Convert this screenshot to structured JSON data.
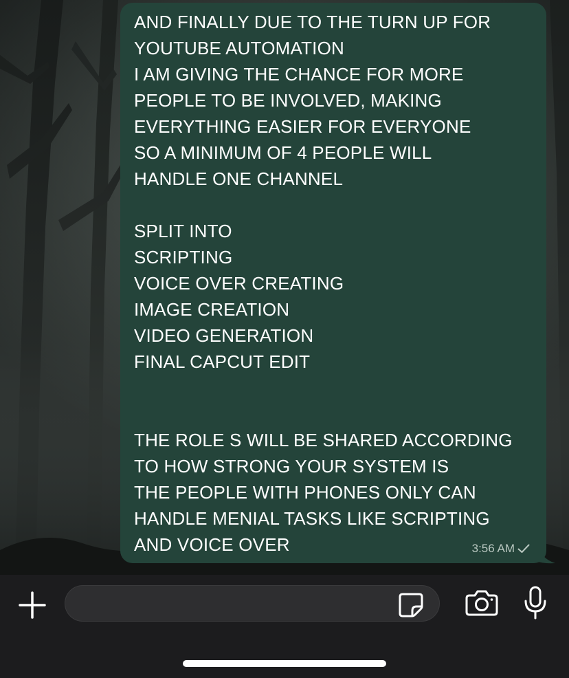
{
  "message": {
    "lines": [
      "AND FINALLY DUE TO THE TURN UP FOR",
      "YOUTUBE AUTOMATION",
      "I AM GIVING THE CHANCE FOR MORE",
      "PEOPLE TO BE INVOLVED, MAKING",
      "EVERYTHING EASIER FOR EVERYONE",
      "SO A MINIMUM OF 4 PEOPLE WILL",
      "HANDLE ONE CHANNEL",
      "",
      "SPLIT INTO",
      "SCRIPTING",
      "VOICE OVER CREATING",
      "IMAGE CREATION",
      "VIDEO GENERATION",
      "FINAL CAPCUT EDIT",
      "",
      "",
      "THE ROLE S WILL BE SHARED ACCORDING",
      "TO HOW STRONG YOUR SYSTEM IS",
      "THE PEOPLE WITH PHONES ONLY CAN",
      "HANDLE MENIAL TASKS LIKE SCRIPTING",
      "AND VOICE OVER"
    ],
    "time": "3:56 AM",
    "status_icon": "single-check-icon"
  },
  "input_bar": {
    "placeholder": "",
    "icons": [
      "plus-icon",
      "sticker-icon",
      "camera-icon",
      "microphone-icon"
    ]
  },
  "colors": {
    "bubble": "#24443a",
    "input_bar": "#1c1c1e",
    "text": "#ffffff"
  }
}
